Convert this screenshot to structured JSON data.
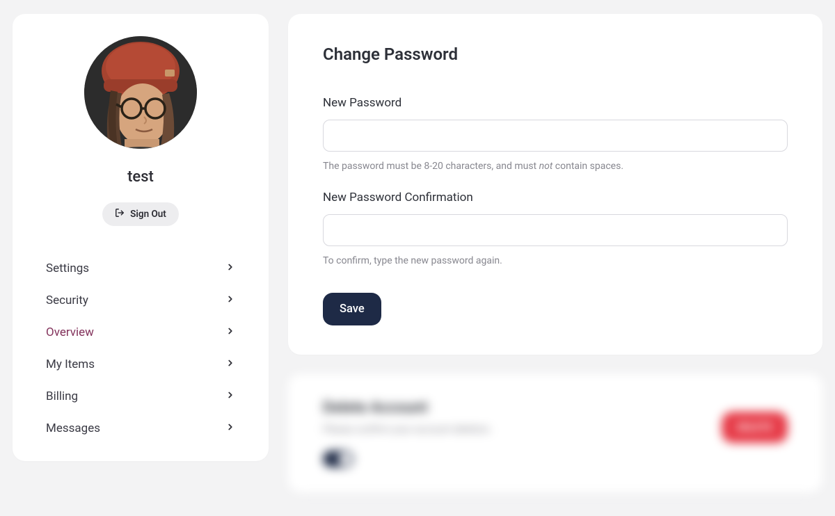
{
  "profile": {
    "username": "test",
    "signout_label": "Sign Out"
  },
  "nav": {
    "items": [
      {
        "label": "Settings",
        "active": false
      },
      {
        "label": "Security",
        "active": false
      },
      {
        "label": "Overview",
        "active": true
      },
      {
        "label": "My Items",
        "active": false
      },
      {
        "label": "Billing",
        "active": false
      },
      {
        "label": "Messages",
        "active": false
      }
    ]
  },
  "changePassword": {
    "title": "Change Password",
    "newPassword": {
      "label": "New Password",
      "value": "",
      "hint_prefix": "The password must be 8-20 characters, and must ",
      "hint_em": "not",
      "hint_suffix": " contain spaces."
    },
    "confirmPassword": {
      "label": "New Password Confirmation",
      "value": "",
      "hint": "To confirm, type the new password again."
    },
    "save_label": "Save"
  },
  "deleteAccount": {
    "title": "Delete Account",
    "description": "Please confirm your account deletion.",
    "button_label": "DELETE",
    "toggle_on": true
  }
}
